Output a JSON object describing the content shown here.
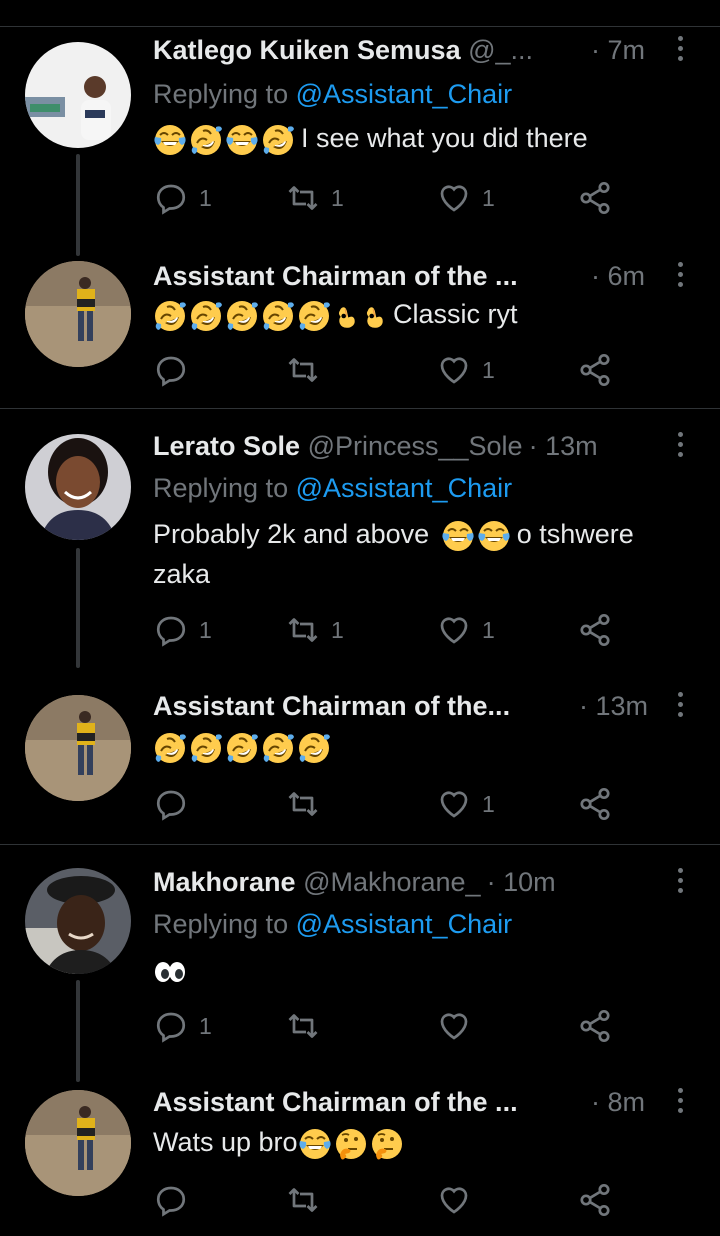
{
  "colors": {
    "background": "#000000",
    "text": "#e7e9ea",
    "muted": "#71767b",
    "link": "#1d9bf0",
    "divider": "#2f3336"
  },
  "tweets": [
    {
      "name": "Katlego Kuiken Semusa",
      "handle": "@_...",
      "time": "· 7m",
      "reply_prefix": "Replying to",
      "reply_to": "@Assistant_Chair",
      "emojis": [
        "face-with-tears-of-joy",
        "rolling-on-the-floor-laughing",
        "face-with-tears-of-joy",
        "rolling-on-the-floor-laughing"
      ],
      "text": "I see what you did there",
      "replies": "1",
      "retweets": "1",
      "likes": "1"
    },
    {
      "name": "Assistant Chairman of the ...",
      "handle": "",
      "time": "· 6m",
      "emojis": [
        "rolling-on-the-floor-laughing",
        "rolling-on-the-floor-laughing",
        "rolling-on-the-floor-laughing",
        "rolling-on-the-floor-laughing",
        "rolling-on-the-floor-laughing",
        "ok-hand",
        "ok-hand"
      ],
      "text": "Classic ryt",
      "replies": "",
      "retweets": "",
      "likes": "1"
    },
    {
      "name": "Lerato Sole",
      "handle": "@Princess__Sole",
      "time": "· 13m",
      "reply_prefix": "Replying to",
      "reply_to": "@Assistant_Chair",
      "text_before": "Probably 2k and above",
      "emojis": [
        "face-with-tears-of-joy",
        "face-with-tears-of-joy"
      ],
      "text_after": "o tshwere",
      "text_line2": "zaka",
      "replies": "1",
      "retweets": "1",
      "likes": "1"
    },
    {
      "name": "Assistant Chairman of the...",
      "handle": "",
      "time": "· 13m",
      "emojis": [
        "rolling-on-the-floor-laughing",
        "rolling-on-the-floor-laughing",
        "rolling-on-the-floor-laughing",
        "rolling-on-the-floor-laughing",
        "rolling-on-the-floor-laughing"
      ],
      "replies": "",
      "retweets": "",
      "likes": "1"
    },
    {
      "name": "Makhorane",
      "handle": "@Makhorane_",
      "time": "· 10m",
      "reply_prefix": "Replying to",
      "reply_to": "@Assistant_Chair",
      "emojis": [
        "eyes"
      ],
      "replies": "1",
      "retweets": "",
      "likes": ""
    },
    {
      "name": "Assistant Chairman of the ...",
      "handle": "",
      "time": "· 8m",
      "text": "Wats up bro",
      "emojis": [
        "face-with-tears-of-joy",
        "thinking-face",
        "thinking-face"
      ],
      "replies": "",
      "retweets": "",
      "likes": ""
    }
  ],
  "icons": {
    "reply": "reply-icon",
    "retweet": "retweet-icon",
    "like": "heart-icon",
    "share": "share-icon",
    "more": "more-icon"
  }
}
